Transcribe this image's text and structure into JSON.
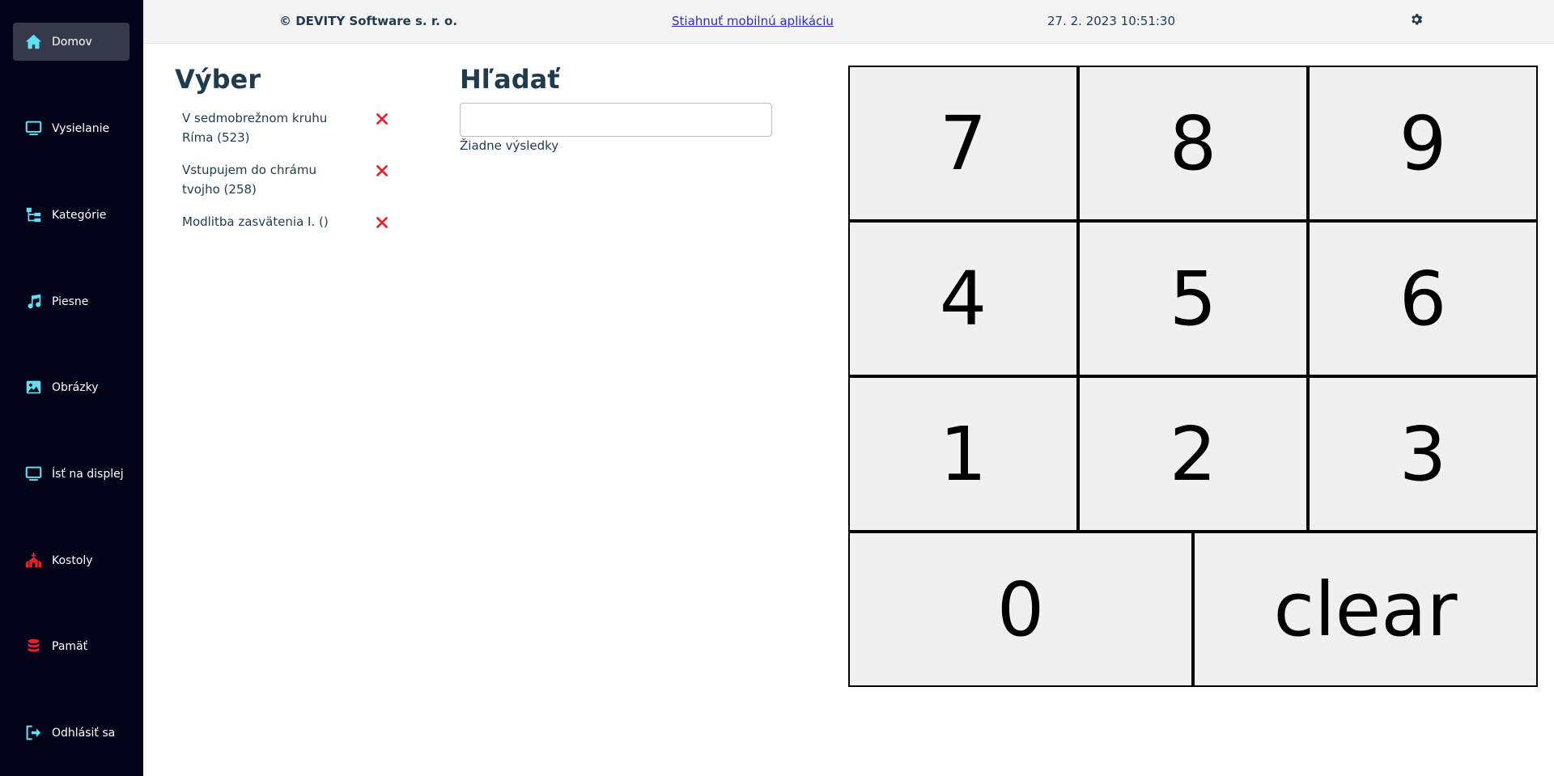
{
  "sidebar": {
    "items": [
      {
        "label": "Domov",
        "icon": "home-icon",
        "icon_color": "#5ee0f0",
        "active": true
      },
      {
        "label": "Vysielanie",
        "icon": "monitor-icon",
        "icon_color": "#5ee0f0"
      },
      {
        "label": "Kategórie",
        "icon": "sitemap-icon",
        "icon_color": "#5ee0f0"
      },
      {
        "label": "Piesne",
        "icon": "music-icon",
        "icon_color": "#5ee0f0"
      },
      {
        "label": "Obrázky",
        "icon": "image-icon",
        "icon_color": "#5ee0f0"
      },
      {
        "label": "Ísť na displej",
        "icon": "monitor-icon",
        "icon_color": "#5ee0f0"
      },
      {
        "label": "Kostoly",
        "icon": "church-icon",
        "icon_color": "#e8202a"
      },
      {
        "label": "Pamäť",
        "icon": "database-icon",
        "icon_color": "#e8202a"
      },
      {
        "label": "Odhlásiť sa",
        "icon": "logout-icon",
        "icon_color": "#5ee0f0"
      }
    ]
  },
  "header": {
    "copyright": "© DEVITY Software s. r. o.",
    "app_link": "Stiahnuť mobilnú aplikáciu",
    "datetime": "27. 2. 2023 10:51:30",
    "settings_icon": "gear-icon"
  },
  "selection": {
    "title": "Výber",
    "items": [
      {
        "label": "V sedmobrežnom kruhu Ríma (523)"
      },
      {
        "label": "Vstupujem do chrámu tvojho (258)"
      },
      {
        "label": "Modlitba zasvätenia I. ()"
      }
    ],
    "remove_color": "#e8202a"
  },
  "search": {
    "title": "Hľadať",
    "value": "",
    "placeholder": "",
    "no_results": "Žiadne výsledky"
  },
  "keypad": {
    "k7": "7",
    "k8": "8",
    "k9": "9",
    "k4": "4",
    "k5": "5",
    "k6": "6",
    "k1": "1",
    "k2": "2",
    "k3": "3",
    "k0": "0",
    "clear": "clear"
  }
}
